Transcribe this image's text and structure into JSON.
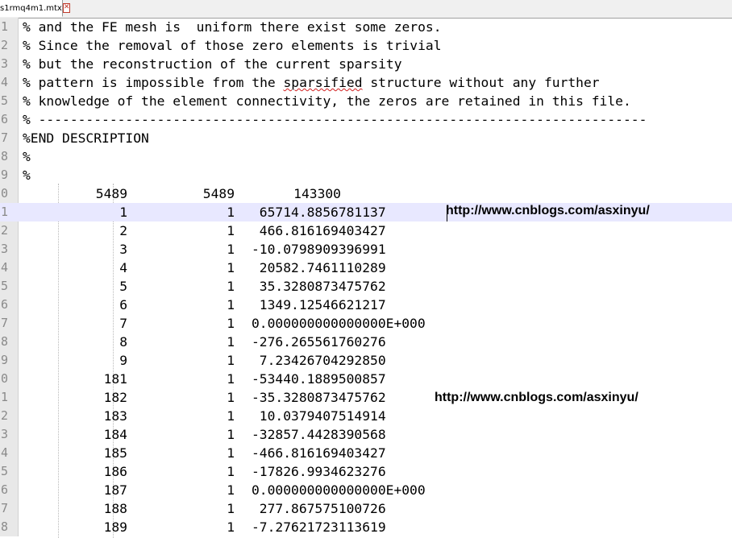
{
  "tab": {
    "filename": "s1rmq4m1.mtx",
    "close_icon": "close-icon"
  },
  "description_lines": [
    {
      "num": "1",
      "text": "% and the FE mesh is  uniform there exist some zeros."
    },
    {
      "num": "2",
      "text": "% Since the removal of those zero elements is trivial"
    },
    {
      "num": "3",
      "text": "% but the reconstruction of the current sparsity"
    },
    {
      "num": "4",
      "pre": "% pattern is impossible from the ",
      "squiggle": "sparsified",
      "post": " structure without any further"
    },
    {
      "num": "5",
      "text": "% knowledge of the element connectivity, the zeros are retained in this file."
    },
    {
      "num": "6",
      "text": "% -----------------------------------------------------------------------------"
    },
    {
      "num": "7",
      "text": "%END DESCRIPTION"
    },
    {
      "num": "8",
      "text": "%"
    },
    {
      "num": "9",
      "text": "%"
    }
  ],
  "header_row": {
    "num": "0",
    "rows": "5489",
    "cols": "5489",
    "nnz": "143300"
  },
  "data_rows": [
    {
      "num": "1",
      "row": "1",
      "col": "1",
      "val": " 65714.8856781137"
    },
    {
      "num": "2",
      "row": "2",
      "col": "1",
      "val": " 466.816169403427"
    },
    {
      "num": "3",
      "row": "3",
      "col": "1",
      "val": "-10.0798909396991"
    },
    {
      "num": "4",
      "row": "4",
      "col": "1",
      "val": " 20582.7461110289"
    },
    {
      "num": "5",
      "row": "5",
      "col": "1",
      "val": " 35.3280873475762"
    },
    {
      "num": "6",
      "row": "6",
      "col": "1",
      "val": " 1349.12546621217"
    },
    {
      "num": "7",
      "row": "7",
      "col": "1",
      "val": "0.000000000000000E+000"
    },
    {
      "num": "8",
      "row": "8",
      "col": "1",
      "val": "-276.265561760276"
    },
    {
      "num": "9",
      "row": "9",
      "col": "1",
      "val": " 7.23426704292850"
    },
    {
      "num": "0",
      "row": "181",
      "col": "1",
      "val": "-53440.1889500857"
    },
    {
      "num": "1",
      "row": "182",
      "col": "1",
      "val": "-35.3280873475762"
    },
    {
      "num": "2",
      "row": "183",
      "col": "1",
      "val": " 10.0379407514914"
    },
    {
      "num": "3",
      "row": "184",
      "col": "1",
      "val": "-32857.4428390568"
    },
    {
      "num": "4",
      "row": "185",
      "col": "1",
      "val": "-466.816169403427"
    },
    {
      "num": "5",
      "row": "186",
      "col": "1",
      "val": "-17826.9934623276"
    },
    {
      "num": "6",
      "row": "187",
      "col": "1",
      "val": "0.000000000000000E+000"
    },
    {
      "num": "7",
      "row": "188",
      "col": "1",
      "val": " 277.867575100726"
    },
    {
      "num": "8",
      "row": "189",
      "col": "1",
      "val": "-7.27621723113619"
    }
  ],
  "watermarks": [
    "http://www.cnblogs.com/asxinyu/",
    "http://www.cnblogs.com/asxinyu/"
  ]
}
